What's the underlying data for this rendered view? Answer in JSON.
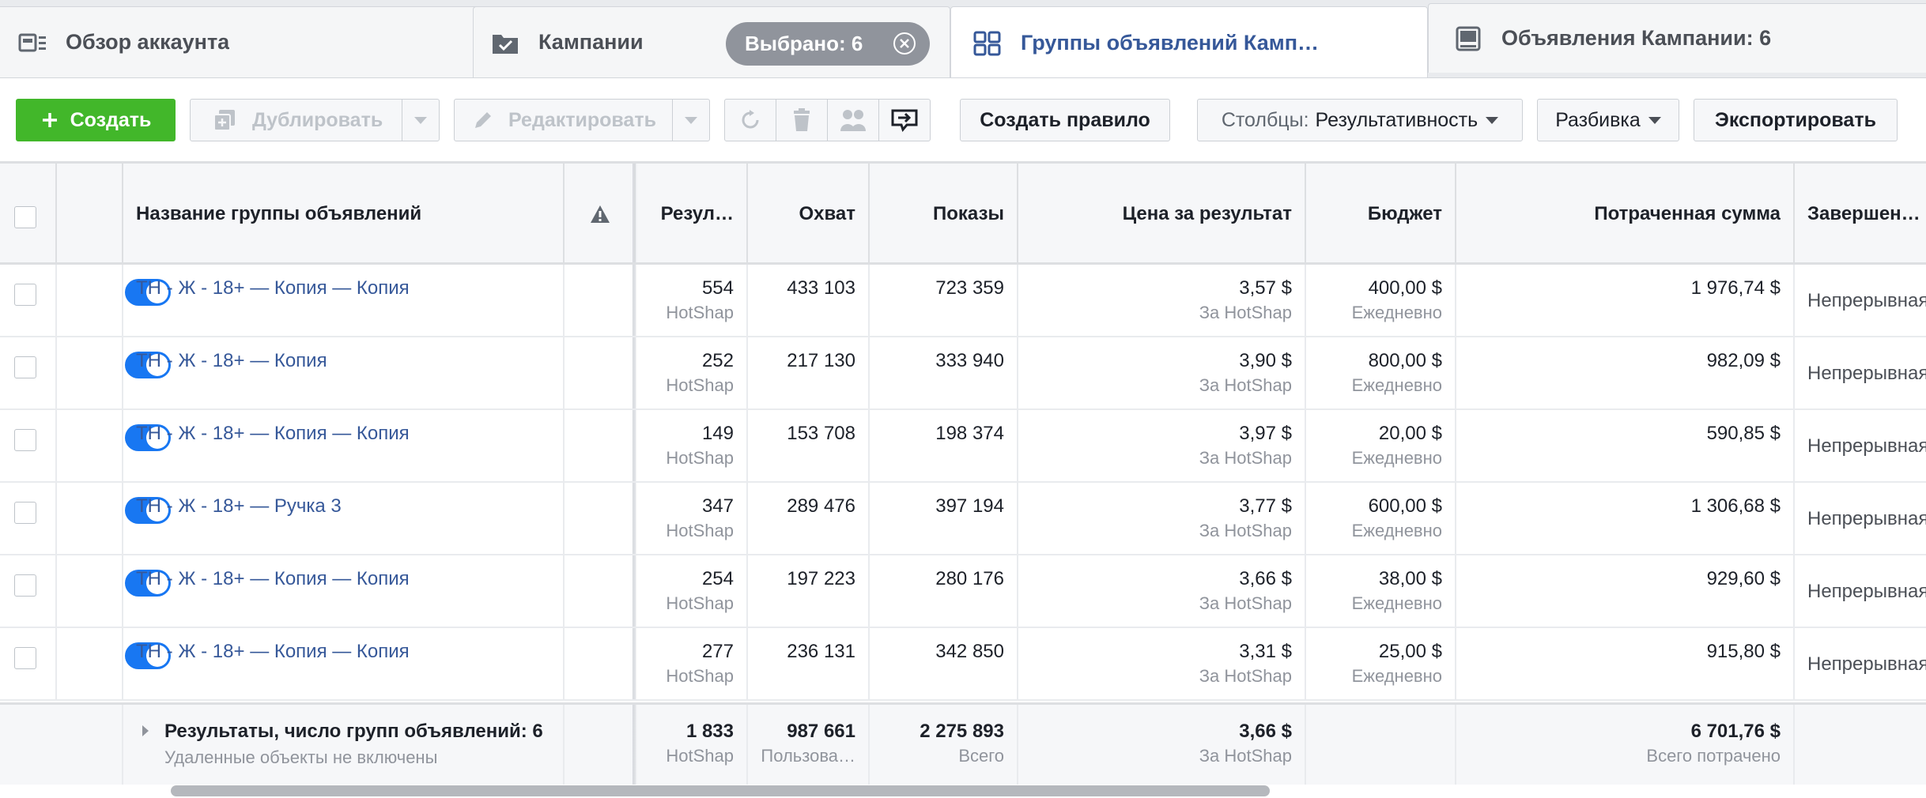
{
  "tabs": {
    "account_overview": "Обзор аккаунта",
    "campaigns": "Кампании",
    "selected": "Выбрано: 6",
    "ad_sets": "Группы объявлений Камп…",
    "ads": "Объявления Кампании: 6"
  },
  "toolbar": {
    "create": "Создать",
    "duplicate": "Дублировать",
    "edit": "Редактировать",
    "create_rule": "Создать правило",
    "columns_prefix": "Столбцы:",
    "columns_value": "Результативность",
    "breakdown": "Разбивка",
    "export": "Экспортировать"
  },
  "table": {
    "headers": {
      "name": "Название группы объявлений",
      "results": "Резул…",
      "reach": "Охват",
      "impressions": "Показы",
      "cost_per_result": "Цена за результат",
      "budget": "Бюджет",
      "amount_spent": "Потраченная сумма",
      "ends": "Завершен…"
    },
    "rows": [
      {
        "name": "ТН - Ж - 18+ — Копия — Копия",
        "results": "554",
        "results_sub": "HotShap",
        "reach": "433 103",
        "impressions": "723 359",
        "cpr": "3,57 $",
        "cpr_sub": "За HotShap",
        "budget": "400,00 $",
        "budget_sub": "Ежедневно",
        "spent": "1 976,74 $",
        "ends": "Непрерывная"
      },
      {
        "name": "ТН - Ж - 18+ — Копия",
        "results": "252",
        "results_sub": "HotShap",
        "reach": "217 130",
        "impressions": "333 940",
        "cpr": "3,90 $",
        "cpr_sub": "За HotShap",
        "budget": "800,00 $",
        "budget_sub": "Ежедневно",
        "spent": "982,09 $",
        "ends": "Непрерывная"
      },
      {
        "name": "ТН - Ж - 18+ — Копия — Копия",
        "results": "149",
        "results_sub": "HotShap",
        "reach": "153 708",
        "impressions": "198 374",
        "cpr": "3,97 $",
        "cpr_sub": "За HotShap",
        "budget": "20,00 $",
        "budget_sub": "Ежедневно",
        "spent": "590,85 $",
        "ends": "Непрерывная"
      },
      {
        "name": "ТН - Ж - 18+ — Ручка 3",
        "results": "347",
        "results_sub": "HotShap",
        "reach": "289 476",
        "impressions": "397 194",
        "cpr": "3,77 $",
        "cpr_sub": "За HotShap",
        "budget": "600,00 $",
        "budget_sub": "Ежедневно",
        "spent": "1 306,68 $",
        "ends": "Непрерывная"
      },
      {
        "name": "ТН - Ж - 18+ — Копия — Копия",
        "results": "254",
        "results_sub": "HotShap",
        "reach": "197 223",
        "impressions": "280 176",
        "cpr": "3,66 $",
        "cpr_sub": "За HotShap",
        "budget": "38,00 $",
        "budget_sub": "Ежедневно",
        "spent": "929,60 $",
        "ends": "Непрерывная"
      },
      {
        "name": "ТН - Ж - 18+ — Копия — Копия",
        "results": "277",
        "results_sub": "HotShap",
        "reach": "236 131",
        "impressions": "342 850",
        "cpr": "3,31 $",
        "cpr_sub": "За HotShap",
        "budget": "25,00 $",
        "budget_sub": "Ежедневно",
        "spent": "915,80 $",
        "ends": "Непрерывная"
      }
    ],
    "footer": {
      "title": "Результаты, число групп объявлений: 6",
      "note": "Удаленные объекты не включены",
      "results": "1 833",
      "results_sub": "HotShap",
      "reach": "987 661",
      "reach_sub": "Пользова…",
      "impressions": "2 275 893",
      "impressions_sub": "Всего",
      "cpr": "3,66 $",
      "cpr_sub": "За HotShap",
      "spent": "6 701,76 $",
      "spent_sub": "Всего потрачено"
    }
  },
  "icons": [
    "account-overview-icon",
    "campaign-folder-icon",
    "close-circle-icon",
    "ad-sets-grid-icon",
    "ad-icon",
    "plus-icon",
    "duplicate-icon",
    "pencil-icon",
    "refresh-icon",
    "trash-icon",
    "ab-test-icon",
    "preview-icon",
    "warning-icon",
    "expand-triangle-icon"
  ],
  "colors": {
    "accent": "#365899",
    "create": "#42b72a",
    "toggle": "#1877f2",
    "pill": "#90949c"
  }
}
